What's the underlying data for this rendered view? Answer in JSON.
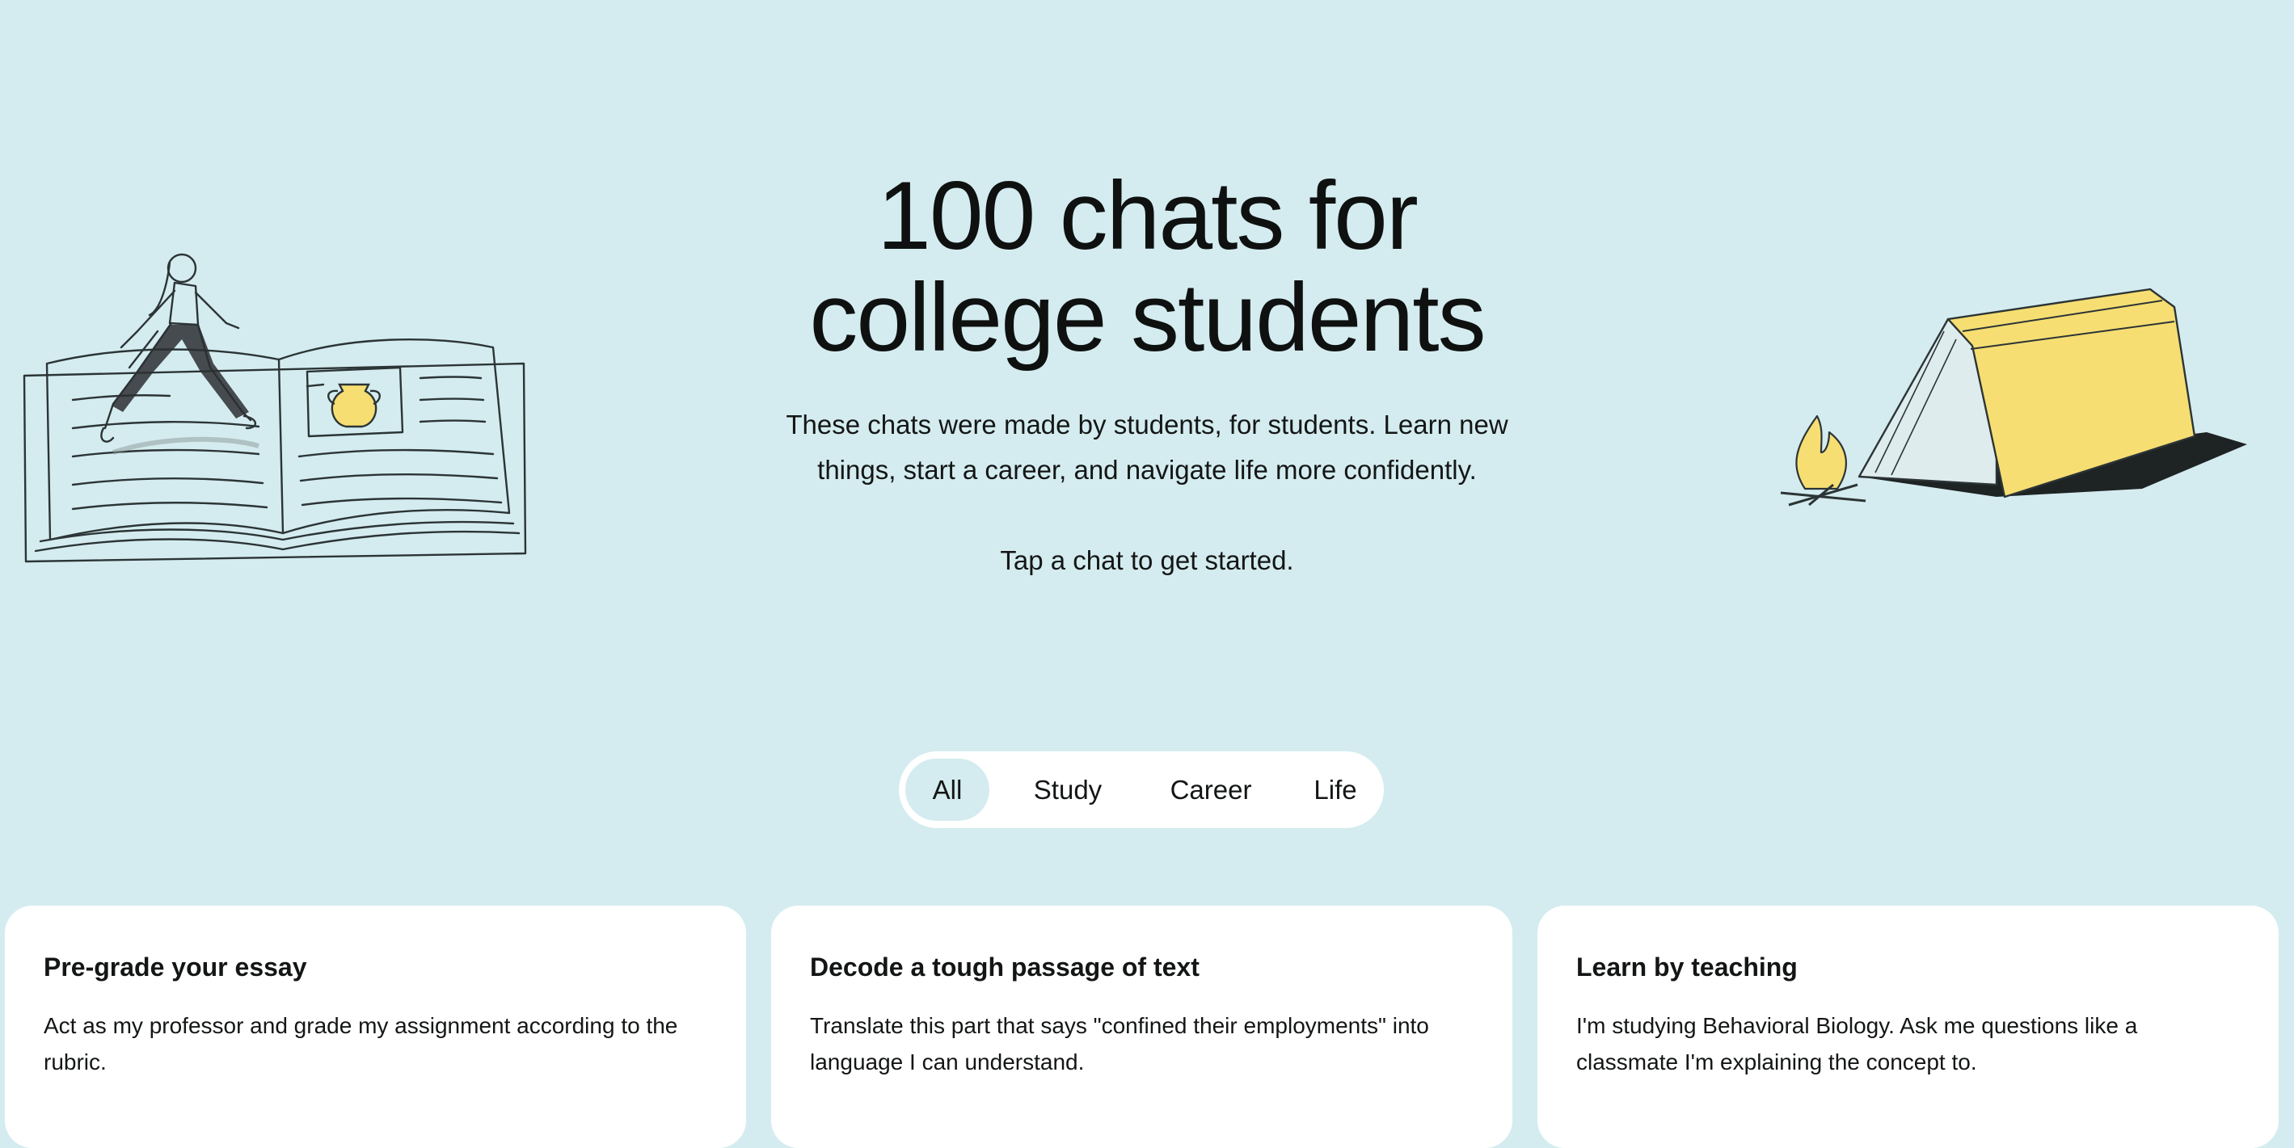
{
  "hero": {
    "title_line1": "100 chats for",
    "title_line2": "college students",
    "subtitle_line1": "These chats were made by students, for students. Learn new",
    "subtitle_line2": "things, start a career, and navigate life more confidently.",
    "cta": "Tap a chat to get started."
  },
  "illustrations": {
    "left": "open-book-with-walking-student-icon",
    "right": "book-tent-with-campfire-icon"
  },
  "tabs": [
    {
      "label": "All",
      "active": true
    },
    {
      "label": "Study",
      "active": false
    },
    {
      "label": "Career",
      "active": false
    },
    {
      "label": "Life",
      "active": false
    }
  ],
  "cards": [
    {
      "title": "Pre-grade your essay",
      "body": "Act as my professor and grade my assignment according to the rubric."
    },
    {
      "title": "Decode a tough passage of text",
      "body": "Translate this part that says \"confined their employments\" into language I can understand."
    },
    {
      "title": "Learn by teaching",
      "body": "I'm studying Behavioral Biology. Ask me questions like a classmate I'm explaining the concept to."
    }
  ],
  "colors": {
    "background": "#d4ecef",
    "card": "#ffffff",
    "text": "#111111",
    "accent_yellow": "#f6de72",
    "active_tab": "#d4ecef"
  }
}
